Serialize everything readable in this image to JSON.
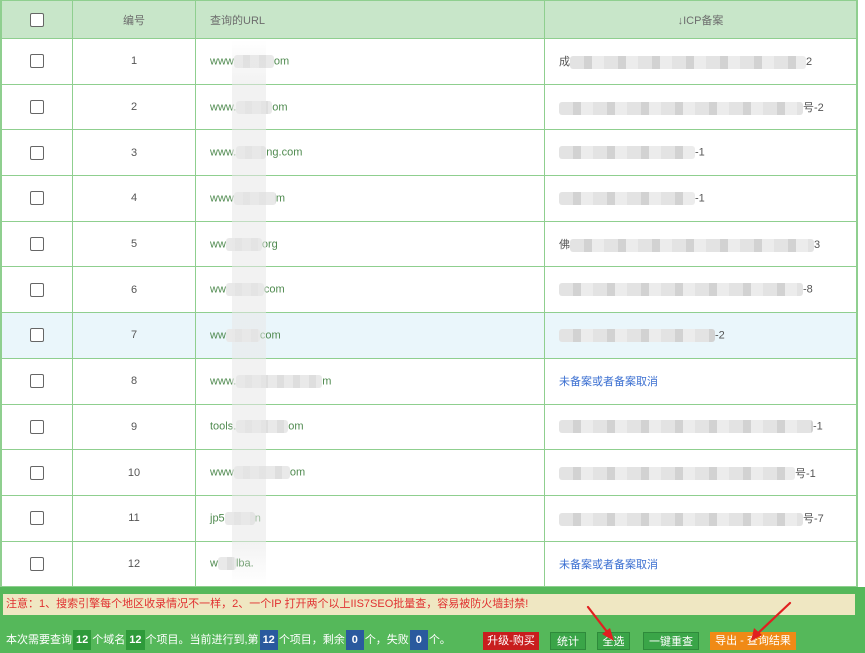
{
  "table": {
    "headers": {
      "number": "编号",
      "url": "查询的URL",
      "icp": "↓ICP备案"
    },
    "rows": [
      {
        "number": "1",
        "url_prefix": "www",
        "url_suffix": "om",
        "icp_prefix": "成",
        "icp_suffix": "2",
        "no_icp": ""
      },
      {
        "number": "2",
        "url_prefix": "www.",
        "url_suffix": "om",
        "icp_prefix": "",
        "icp_suffix": "号-2",
        "no_icp": ""
      },
      {
        "number": "3",
        "url_prefix": "www.",
        "url_suffix": "ng.com",
        "icp_prefix": "",
        "icp_suffix": "-1",
        "no_icp": ""
      },
      {
        "number": "4",
        "url_prefix": "www",
        "url_suffix": "m",
        "icp_prefix": "",
        "icp_suffix": "-1",
        "no_icp": ""
      },
      {
        "number": "5",
        "url_prefix": "ww",
        "url_suffix": "org",
        "icp_prefix": "佛",
        "icp_suffix": "3",
        "no_icp": ""
      },
      {
        "number": "6",
        "url_prefix": "ww",
        "url_suffix": "com",
        "icp_prefix": "",
        "icp_suffix": "-8",
        "no_icp": ""
      },
      {
        "number": "7",
        "url_prefix": "ww",
        "url_suffix": "com",
        "icp_prefix": "",
        "icp_suffix": "-2",
        "no_icp": ""
      },
      {
        "number": "8",
        "url_prefix": "www.",
        "url_suffix": "m",
        "icp_prefix": "",
        "icp_suffix": "",
        "no_icp": "未备案或者备案取消"
      },
      {
        "number": "9",
        "url_prefix": "tools.",
        "url_suffix": "om",
        "icp_prefix": "",
        "icp_suffix": "-1",
        "no_icp": ""
      },
      {
        "number": "10",
        "url_prefix": "www",
        "url_suffix": "om",
        "icp_prefix": "",
        "icp_suffix": "号-1",
        "no_icp": ""
      },
      {
        "number": "11",
        "url_prefix": "jp5",
        "url_suffix": "n",
        "icp_prefix": "",
        "icp_suffix": "号-7",
        "no_icp": ""
      },
      {
        "number": "12",
        "url_prefix": "w",
        "url_suffix": "lba.",
        "icp_prefix": "",
        "icp_suffix": "",
        "no_icp": "未备案或者备案取消"
      }
    ]
  },
  "notice": "注意：1、搜索引擎每个地区收录情况不一样，2、一个IP 打开两个以上IIS7SEO批量查，容易被防火墙封禁!",
  "status": {
    "t1": "本次需要查询",
    "n1": "12",
    "t2": "个域名",
    "n2": "12",
    "t3": "个项目。当前进行到,第",
    "n3": "12",
    "t4": "个项目，剩余",
    "n4": "0",
    "t5": "个，失败",
    "n5": "0",
    "t6": "个。"
  },
  "buttons": {
    "upgrade": "升级-购买",
    "stats": "统计",
    "select_all": "全选",
    "recheck": "一键重查",
    "export": "导出 - 查询结果"
  },
  "colors": {
    "header_bg": "#c8e6c9",
    "border": "#8fcf8f",
    "footer_bg": "#55b85a",
    "notice_text": "#e03030",
    "upgrade_btn": "#c81e1e",
    "export_btn": "#f08a16",
    "arrow": "#e02020"
  }
}
